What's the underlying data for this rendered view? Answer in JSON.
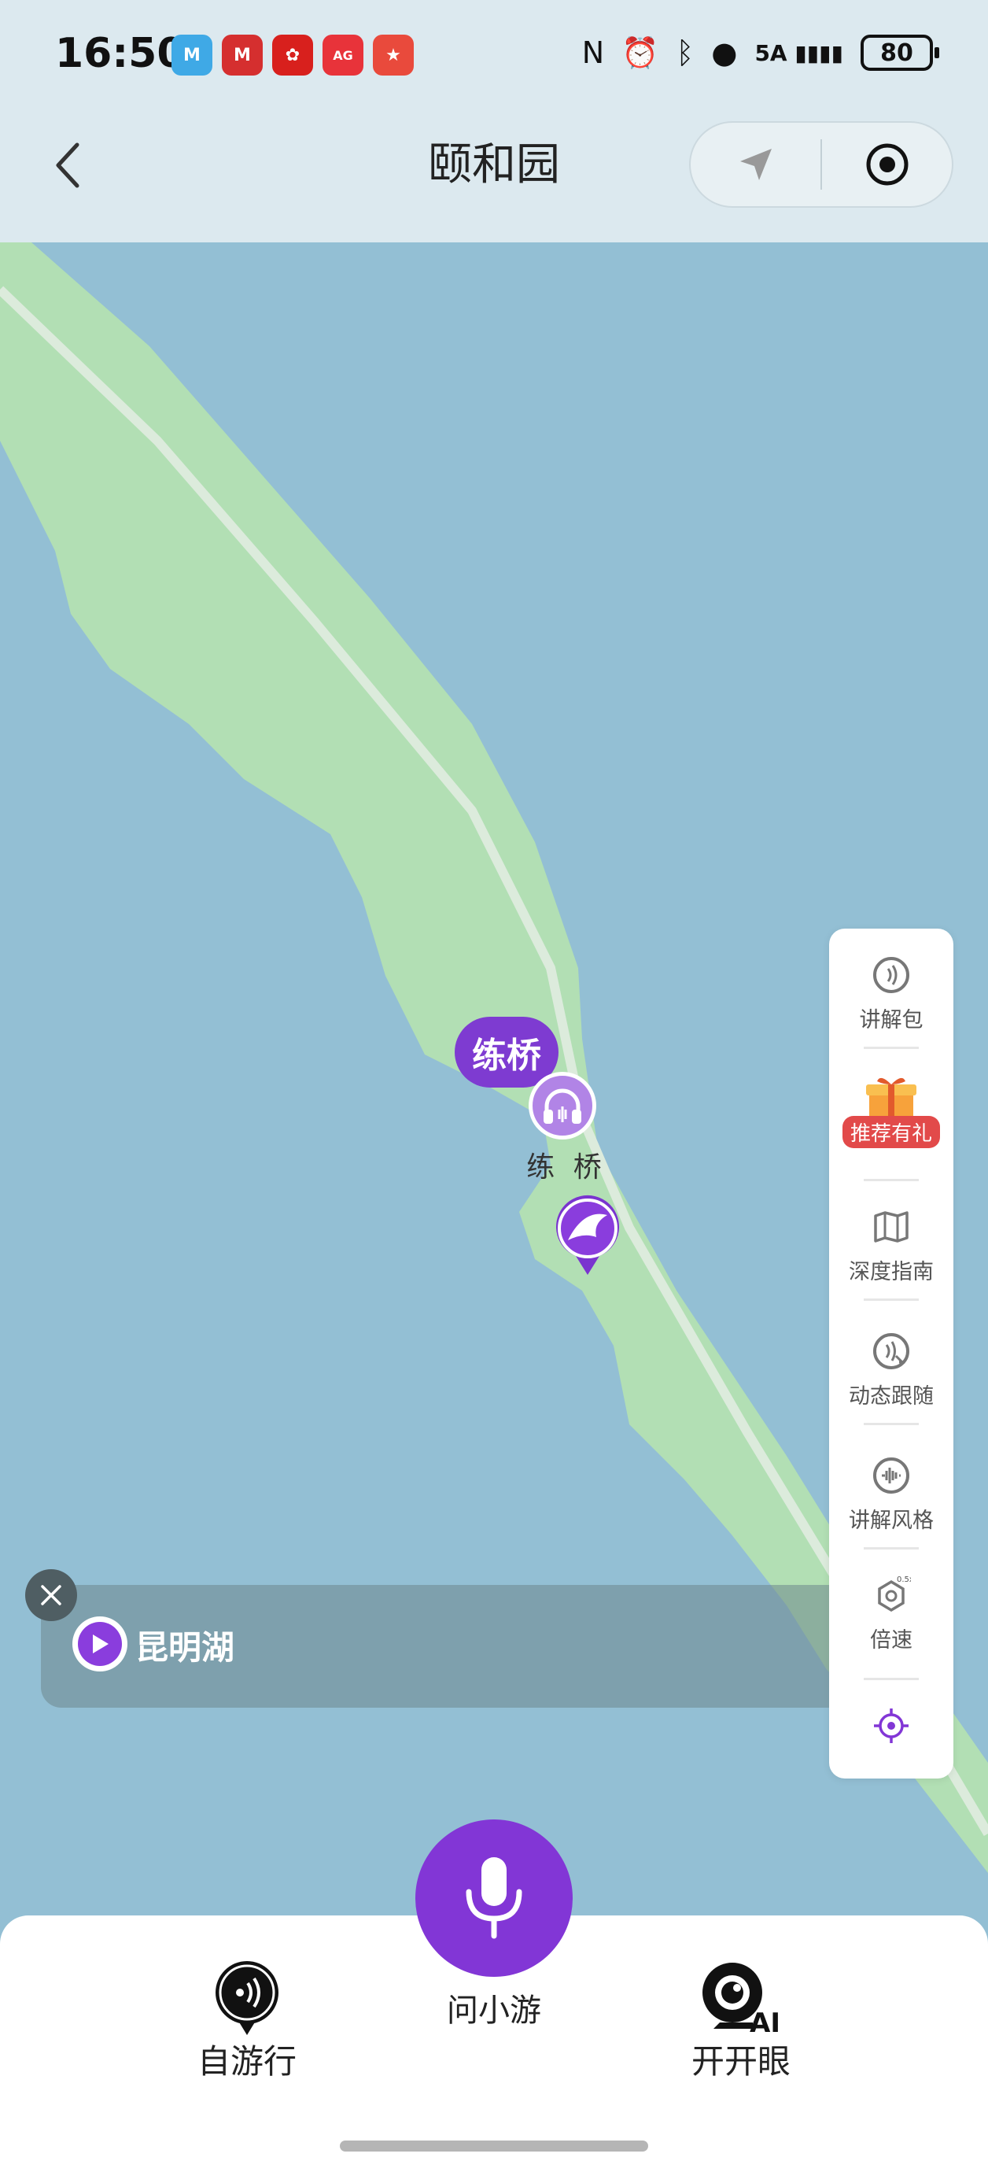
{
  "status_bar": {
    "time": "16:50",
    "battery": "80",
    "network": "5A",
    "apps": [
      {
        "name": "metro-app-icon",
        "color": "#3fa9e6",
        "text": "M"
      },
      {
        "name": "bank-app-icon",
        "color": "#d52f2f",
        "text": "M"
      },
      {
        "name": "flower-app-icon",
        "color": "#d8201d",
        "text": "✿"
      },
      {
        "name": "app-gallery-icon",
        "color": "#e8333a",
        "text": "AG"
      },
      {
        "name": "game-app-icon",
        "color": "#e94a3c",
        "text": "★"
      }
    ]
  },
  "nav": {
    "title": "颐和园"
  },
  "map": {
    "place_tag": "练桥",
    "place_label": "练 桥"
  },
  "tools": {
    "audio_pack": "讲解包",
    "gift": "推荐有礼",
    "guide": "深度指南",
    "follow": "动态跟随",
    "style": "讲解风格",
    "speed": "倍速",
    "speed_badge": "0.5x"
  },
  "audio_strip": {
    "title": "昆明湖"
  },
  "bottom": {
    "self_tour": "自游行",
    "ask": "问小游",
    "open_eye": "开开眼",
    "ai_badge": "AI"
  },
  "colors": {
    "water": "#93bfd4",
    "land": "#b2dfb4",
    "accent": "#8236d6"
  }
}
